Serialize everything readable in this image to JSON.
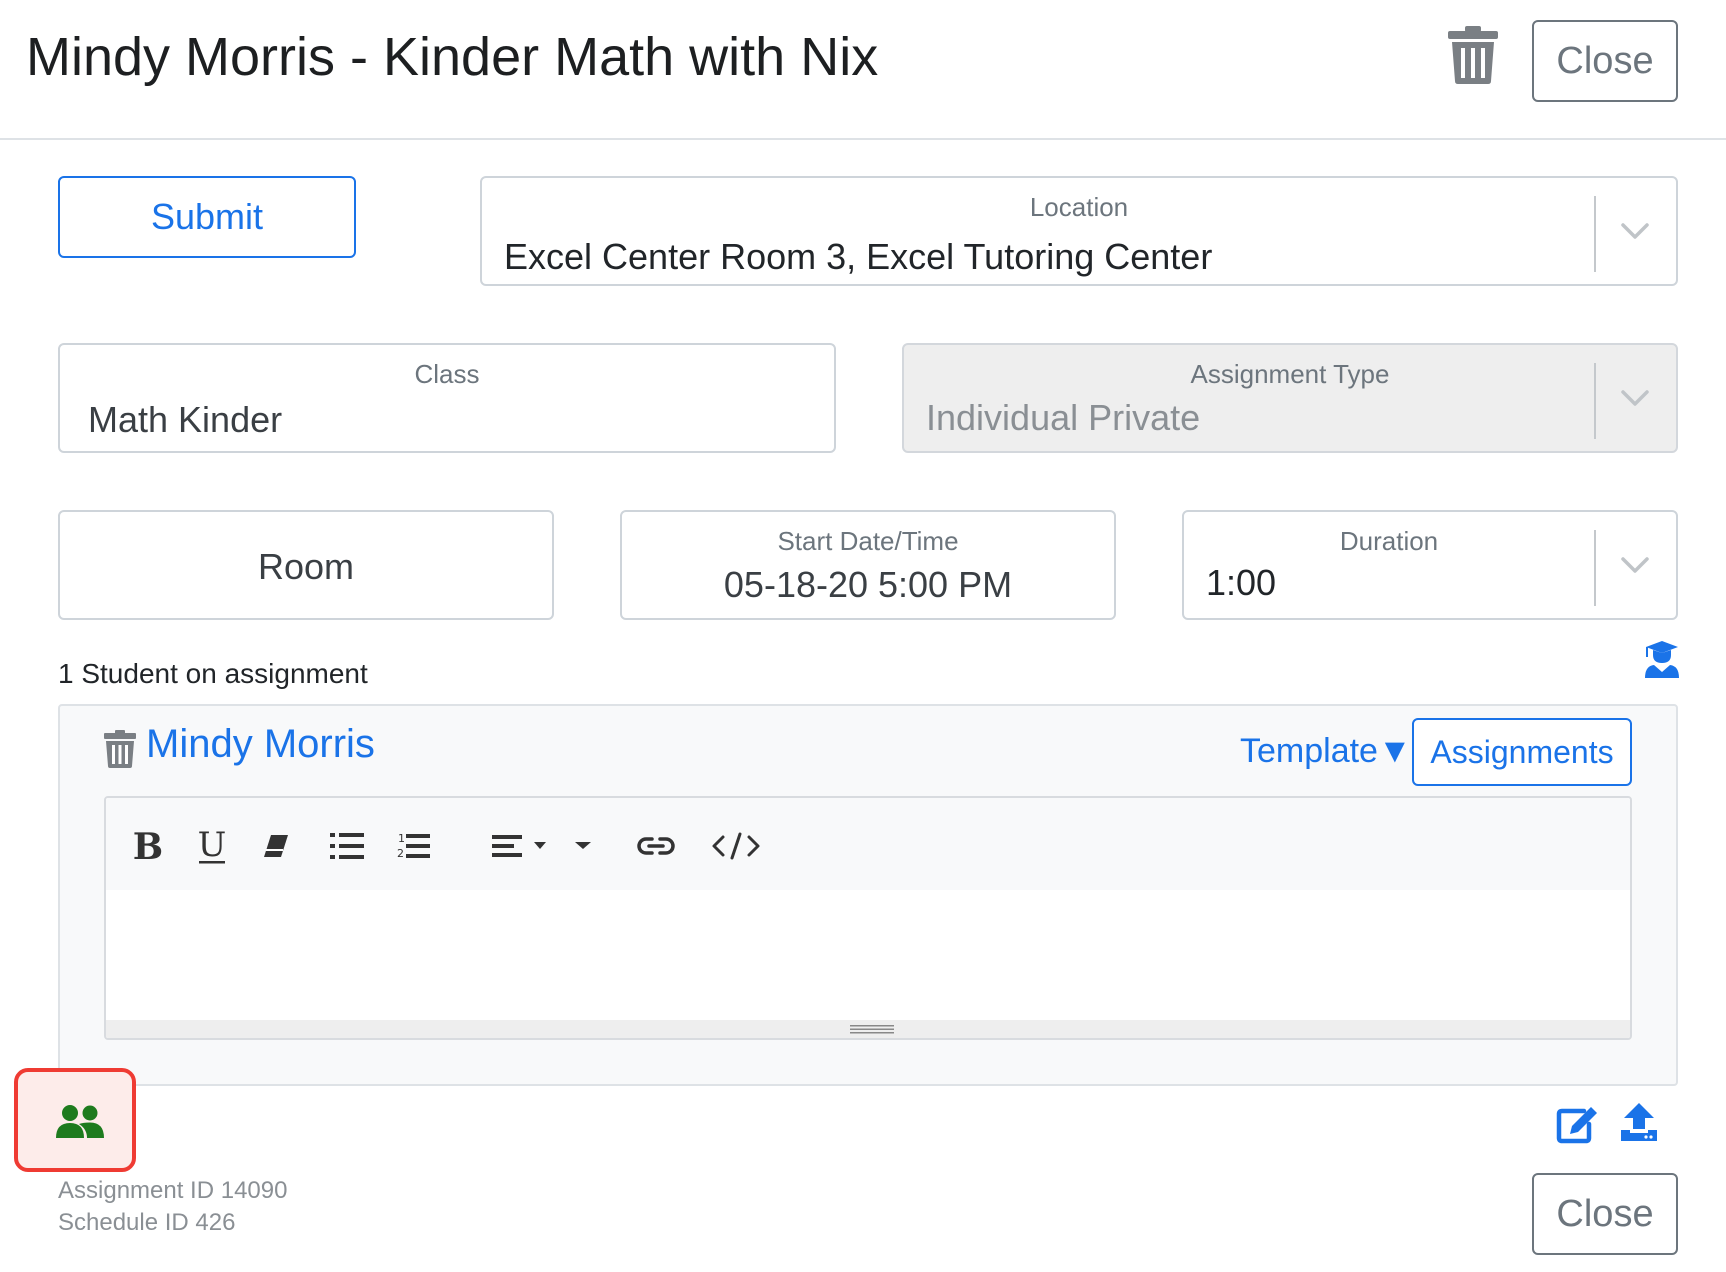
{
  "header": {
    "title": "Mindy Morris - Kinder Math with Nix",
    "close_label": "Close"
  },
  "form": {
    "submit_label": "Submit",
    "location": {
      "label": "Location",
      "value": "Excel Center Room 3, Excel Tutoring Center"
    },
    "class": {
      "label": "Class",
      "value": "Math Kinder"
    },
    "assignment_type": {
      "label": "Assignment Type",
      "value": "Individual Private"
    },
    "room": {
      "placeholder": "Room"
    },
    "start": {
      "label": "Start Date/Time",
      "value": "05-18-20 5:00 PM"
    },
    "duration": {
      "label": "Duration",
      "value": "1:00"
    }
  },
  "students": {
    "count_label": "1 Student on assignment",
    "items": [
      {
        "name": "Mindy Morris",
        "template_label": "Template▼",
        "assignments_label": "Assignments"
      }
    ]
  },
  "editor": {
    "toolbar": [
      "bold-icon",
      "underline-icon",
      "eraser-icon",
      "unordered-list-icon",
      "ordered-list-icon",
      "align-icon",
      "more-caret-icon",
      "link-icon",
      "code-icon"
    ]
  },
  "footer": {
    "assignment_id": "Assignment ID 14090",
    "schedule_id": "Schedule ID 426",
    "close_label": "Close"
  },
  "colors": {
    "accent": "#1a73e8",
    "group_icon": "#1e7b1e",
    "highlight_border": "#ef3b33",
    "muted": "#6c757d"
  }
}
